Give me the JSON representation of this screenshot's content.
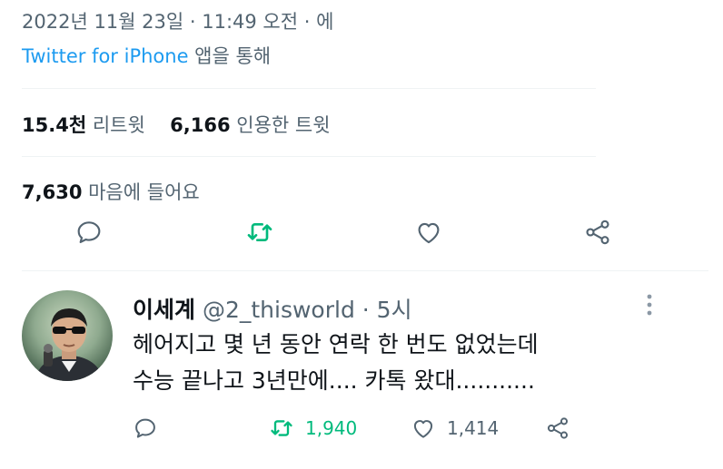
{
  "tweet": {
    "timestamp": "2022년 11월 23일 · 11:49 오전 · 에",
    "source_app": "Twitter for iPhone",
    "source_suffix": " 앱을 통해",
    "retweets_count": "15.4천",
    "retweets_label": " 리트윗",
    "quotes_count": "6,166",
    "quotes_label": " 인용한 트윗",
    "likes_count": "7,630",
    "likes_label": " 마음에 들어요"
  },
  "actions": [
    "reply-icon",
    "retweet-icon",
    "heart-icon",
    "share-icon"
  ],
  "reply": {
    "name": "이세계",
    "handle": " @2_thisworld",
    "time": " · 5시",
    "line1": "헤어지고 몇 년 동안 연락 한 번도 없었는데",
    "line2": "수능 끝나고 3년만에.... 카톡 왔대...........",
    "retweets": "1,940",
    "likes": "1,414"
  },
  "colors": {
    "accent": "#1d9bf0",
    "retweet_green": "#00ba7c",
    "muted": "#536471",
    "text": "#0f1419"
  }
}
